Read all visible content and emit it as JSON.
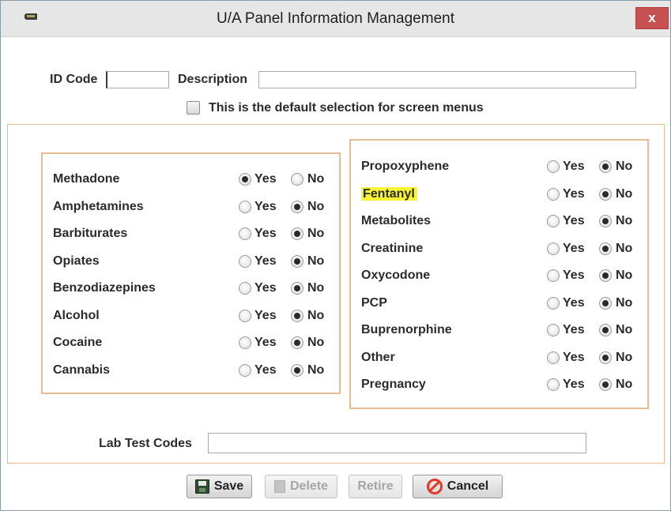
{
  "window": {
    "title": "U/A Panel Information Management",
    "close_label": "x"
  },
  "form": {
    "id_code_label": "ID Code",
    "id_code_value": "",
    "description_label": "Description",
    "description_value": "",
    "default_checkbox_label": "This is the default selection for screen menus",
    "default_checked": false,
    "lab_test_codes_label": "Lab Test Codes",
    "lab_test_codes_value": ""
  },
  "options": {
    "yes": "Yes",
    "no": "No"
  },
  "left_panel": [
    {
      "name": "Methadone",
      "selected": "yes"
    },
    {
      "name": "Amphetamines",
      "selected": "no"
    },
    {
      "name": "Barbiturates",
      "selected": "no"
    },
    {
      "name": "Opiates",
      "selected": "no"
    },
    {
      "name": "Benzodiazepines",
      "selected": "no"
    },
    {
      "name": "Alcohol",
      "selected": "no"
    },
    {
      "name": "Cocaine",
      "selected": "no"
    },
    {
      "name": "Cannabis",
      "selected": "no"
    }
  ],
  "right_panel": [
    {
      "name": "Propoxyphene",
      "selected": "no"
    },
    {
      "name": "Fentanyl",
      "selected": "no",
      "highlighted": true
    },
    {
      "name": "Metabolites",
      "selected": "no"
    },
    {
      "name": "Creatinine",
      "selected": "no"
    },
    {
      "name": "Oxycodone",
      "selected": "no"
    },
    {
      "name": "PCP",
      "selected": "no"
    },
    {
      "name": "Buprenorphine",
      "selected": "no"
    },
    {
      "name": "Other",
      "selected": "no"
    },
    {
      "name": "Pregnancy",
      "selected": "no"
    }
  ],
  "buttons": {
    "save": "Save",
    "delete": "Delete",
    "retire": "Retire",
    "cancel": "Cancel"
  },
  "icons": {
    "app": "app-icon",
    "save": "floppy-disk-icon",
    "delete": "trash-icon",
    "cancel": "no-entry-icon"
  },
  "colors": {
    "panel_border": "#e4bd96",
    "highlight": "#f7f531",
    "close_button": "#c75050",
    "cancel_icon": "#e23a2a"
  }
}
